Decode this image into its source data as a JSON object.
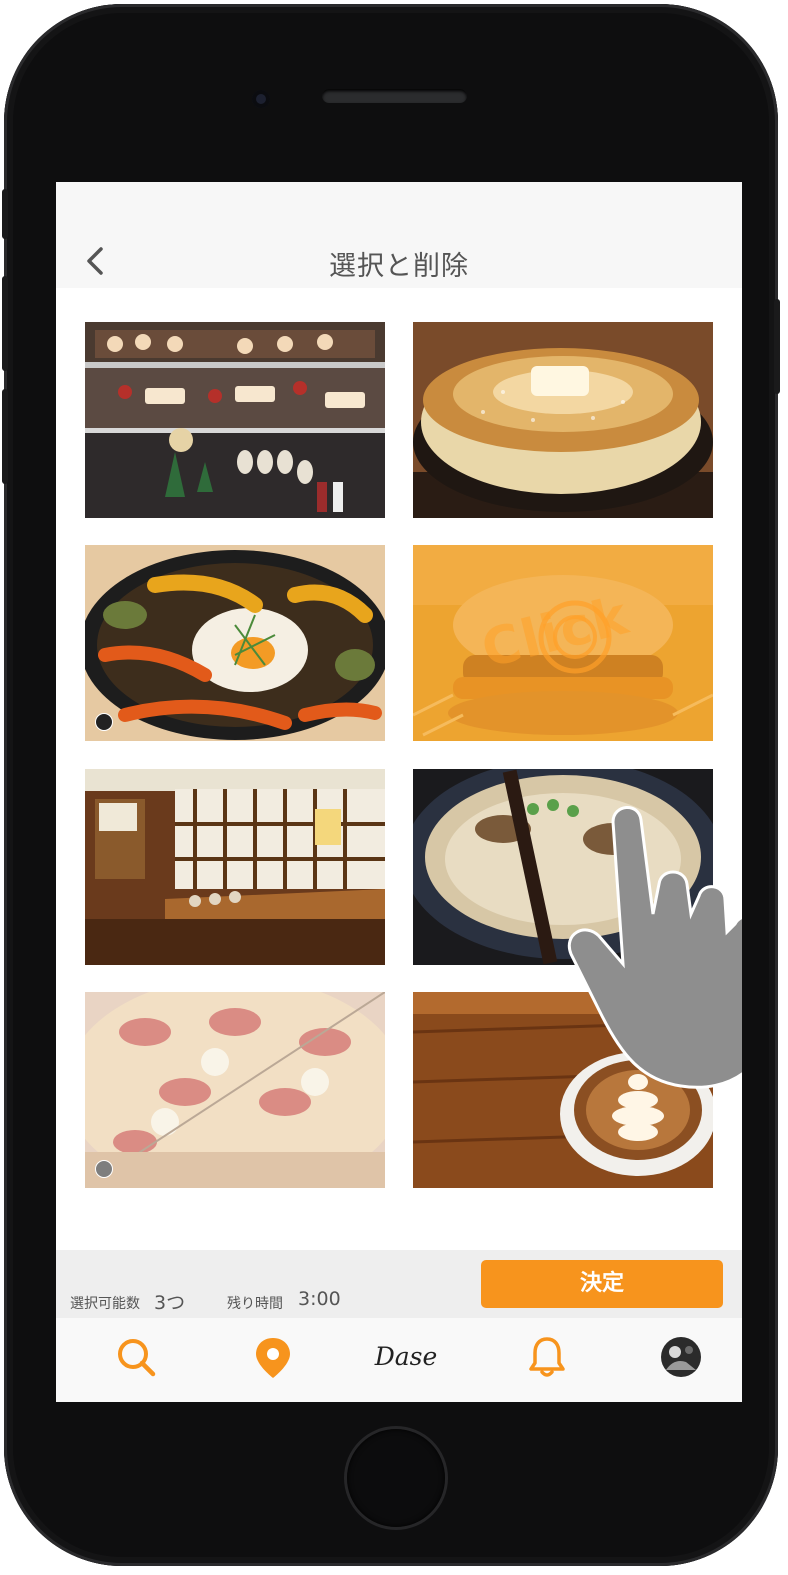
{
  "header": {
    "title": "選択と削除"
  },
  "grid": {
    "photos": [
      {
        "subject": "pastry display case"
      },
      {
        "subject": "souffle pancake with butter"
      },
      {
        "subject": "roasted vegetables and egg skillet"
      },
      {
        "subject": "burger"
      },
      {
        "subject": "restaurant interior"
      },
      {
        "subject": "ramen bowl"
      },
      {
        "subject": "pizza"
      },
      {
        "subject": "latte art coffee"
      }
    ],
    "click_text": "Click"
  },
  "footer": {
    "available_label": "選択可能数",
    "available_value": "3つ",
    "remaining_label": "残り時間",
    "remaining_value": "3:00",
    "confirm_label": "決定"
  },
  "tabbar": {
    "brand": "Dase",
    "icons": [
      "search-icon",
      "map-pin-icon",
      "brand-logo",
      "bell-icon",
      "profile-avatar"
    ]
  },
  "colors": {
    "accent": "#f7941d",
    "title_text": "#555555"
  }
}
